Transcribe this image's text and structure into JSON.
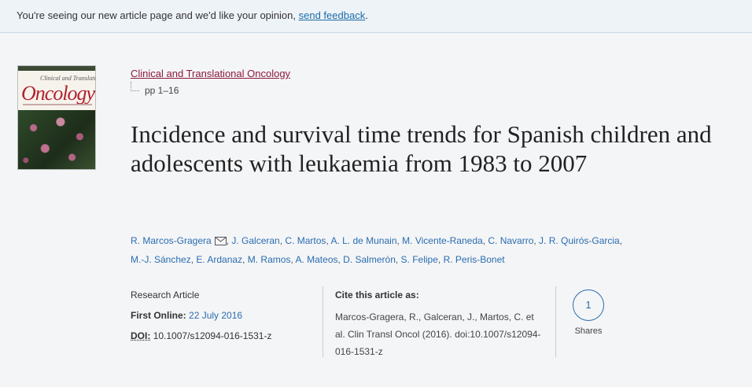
{
  "banner": {
    "text": "You're seeing our new article page and we'd like your opinion,",
    "link": "send feedback",
    "suffix": "."
  },
  "cover": {
    "small_title": "Clinical and Translational",
    "title": "Oncology"
  },
  "journal": {
    "name": "Clinical and Translational Oncology",
    "pages": "pp 1–16"
  },
  "article": {
    "title": "Incidence and survival time trends for Spanish children and adolescents with leukaemia from 1983 to 2007"
  },
  "authors": [
    "R. Marcos-Gragera",
    "J. Galceran",
    "C. Martos",
    "A. L. de Munain",
    "M. Vicente-Raneda",
    "C. Navarro",
    "J. R. Quirós-Garcia",
    "M.-J. Sánchez",
    "E. Ardanaz",
    "M. Ramos",
    "A. Mateos",
    "D. Salmerón",
    "S. Felipe",
    "R. Peris-Bonet"
  ],
  "meta": {
    "type": "Research Article",
    "first_online_label": "First Online:",
    "first_online_date": "22 July 2016",
    "doi_label": "DOI:",
    "doi": "10.1007/s12094-016-1531-z"
  },
  "cite": {
    "heading": "Cite this article as:",
    "text": "Marcos-Gragera, R., Galceran, J., Martos, C. et al. Clin Transl Oncol (2016). doi:10.1007/s12094-016-1531-z"
  },
  "shares": {
    "count": "1",
    "label": "Shares"
  },
  "colors": {
    "link": "#2a6db0",
    "journal_link": "#8b1a3a",
    "banner_bg": "#eef3f8"
  }
}
